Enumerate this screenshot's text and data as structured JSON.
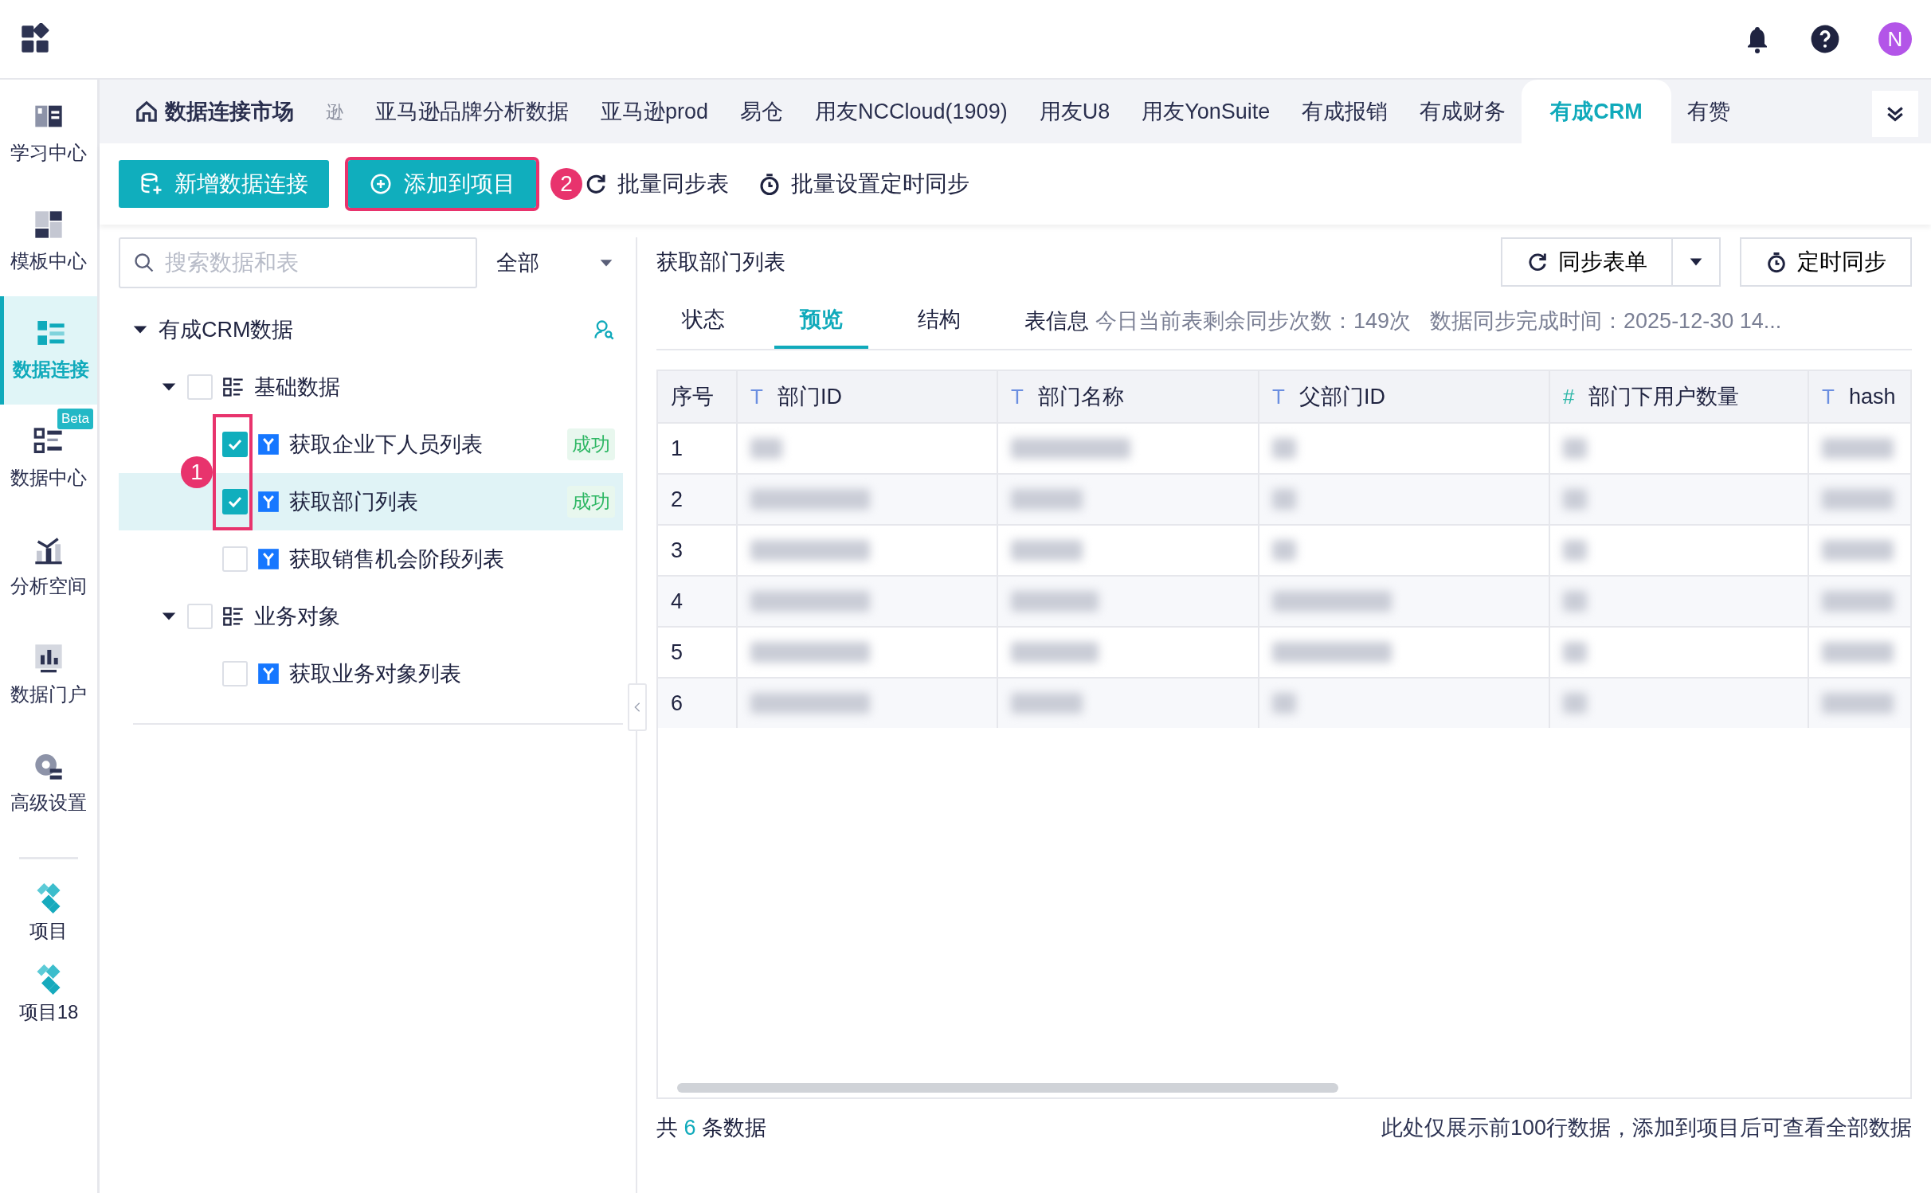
{
  "sidebar": {
    "items": [
      {
        "label": "学习中心",
        "selected": false
      },
      {
        "label": "模板中心",
        "selected": false
      },
      {
        "label": "数据连接",
        "selected": true
      },
      {
        "label": "数据中心",
        "selected": false,
        "badge": "Beta"
      },
      {
        "label": "分析空间",
        "selected": false
      },
      {
        "label": "数据门户",
        "selected": false
      },
      {
        "label": "高级设置",
        "selected": false
      }
    ],
    "projects": [
      {
        "label": "项目"
      },
      {
        "label": "项目18"
      }
    ]
  },
  "header": {
    "avatar": "N"
  },
  "tabs": [
    {
      "label": "数据连接市场",
      "kind": "home",
      "selected": false
    },
    {
      "label": "逊",
      "kind": "faded",
      "selected": false
    },
    {
      "label": "亚马逊品牌分析数据",
      "kind": "tab",
      "selected": false
    },
    {
      "label": "亚马逊prod",
      "kind": "tab",
      "selected": false
    },
    {
      "label": "易仓",
      "kind": "tab",
      "selected": false
    },
    {
      "label": "用友NCCloud(1909)",
      "kind": "tab",
      "selected": false
    },
    {
      "label": "用友U8",
      "kind": "tab",
      "selected": false
    },
    {
      "label": "用友YonSuite",
      "kind": "tab",
      "selected": false
    },
    {
      "label": "有成报销",
      "kind": "tab",
      "selected": false
    },
    {
      "label": "有成财务",
      "kind": "tab",
      "selected": false
    },
    {
      "label": "有成CRM",
      "kind": "tab",
      "selected": true
    },
    {
      "label": "有赞",
      "kind": "tab",
      "selected": false
    }
  ],
  "toolbar": [
    {
      "label": "新增数据连接",
      "kind": "primary",
      "highlighted": false
    },
    {
      "label": "添加到项目",
      "kind": "primary",
      "highlighted": true,
      "callout": "2"
    },
    {
      "label": "批量同步表",
      "kind": "sync",
      "highlighted": false
    },
    {
      "label": "批量设置定时同步",
      "kind": "timer",
      "highlighted": false
    }
  ],
  "search": {
    "placeholder": "搜索数据和表",
    "filter": "全部"
  },
  "tree": {
    "label": "有成CRM数据",
    "expanded": true,
    "children": [
      {
        "label": "基础数据",
        "expanded": true,
        "checked": false,
        "children": [
          {
            "label": "获取企业下人员列表",
            "checked": true,
            "selected": false,
            "status": "成功"
          },
          {
            "label": "获取部门列表",
            "checked": true,
            "selected": true,
            "status": "成功"
          },
          {
            "label": "获取销售机会阶段列表",
            "checked": false,
            "selected": false
          }
        ]
      },
      {
        "label": "业务对象",
        "expanded": true,
        "checked": false,
        "children": [
          {
            "label": "获取业务对象列表",
            "checked": false,
            "selected": false
          }
        ]
      }
    ]
  },
  "checkbox_callout": "1",
  "detail": {
    "title": "获取部门列表",
    "sync_button": "同步表单",
    "timer_button": "定时同步",
    "tabs": [
      {
        "label": "状态",
        "selected": false
      },
      {
        "label": "预览",
        "selected": true
      },
      {
        "label": "结构",
        "selected": false
      }
    ],
    "info_label": "表信息",
    "info_text": "今日当前表剩余同步次数：149次",
    "sync_time": "数据同步完成时间：2025-12-30 14...",
    "table": {
      "columns": [
        {
          "label": "序号"
        },
        {
          "label": "部门ID",
          "type_mark": "T",
          "kind": "text"
        },
        {
          "label": "部门名称",
          "type_mark": "T",
          "kind": "text"
        },
        {
          "label": "父部门ID",
          "type_mark": "T",
          "kind": "text"
        },
        {
          "label": "部门下用户数量",
          "type_mark": "#",
          "kind": "number"
        },
        {
          "label": "hash",
          "type_mark": "T",
          "kind": "text"
        }
      ],
      "rows": [
        "1",
        "2",
        "3",
        "4",
        "5",
        "6"
      ]
    },
    "footer": {
      "prefix": "共",
      "count": "6",
      "suffix": "条数据",
      "note": "此处仅展示前100行数据，添加到项目后可查看全部数据"
    }
  }
}
